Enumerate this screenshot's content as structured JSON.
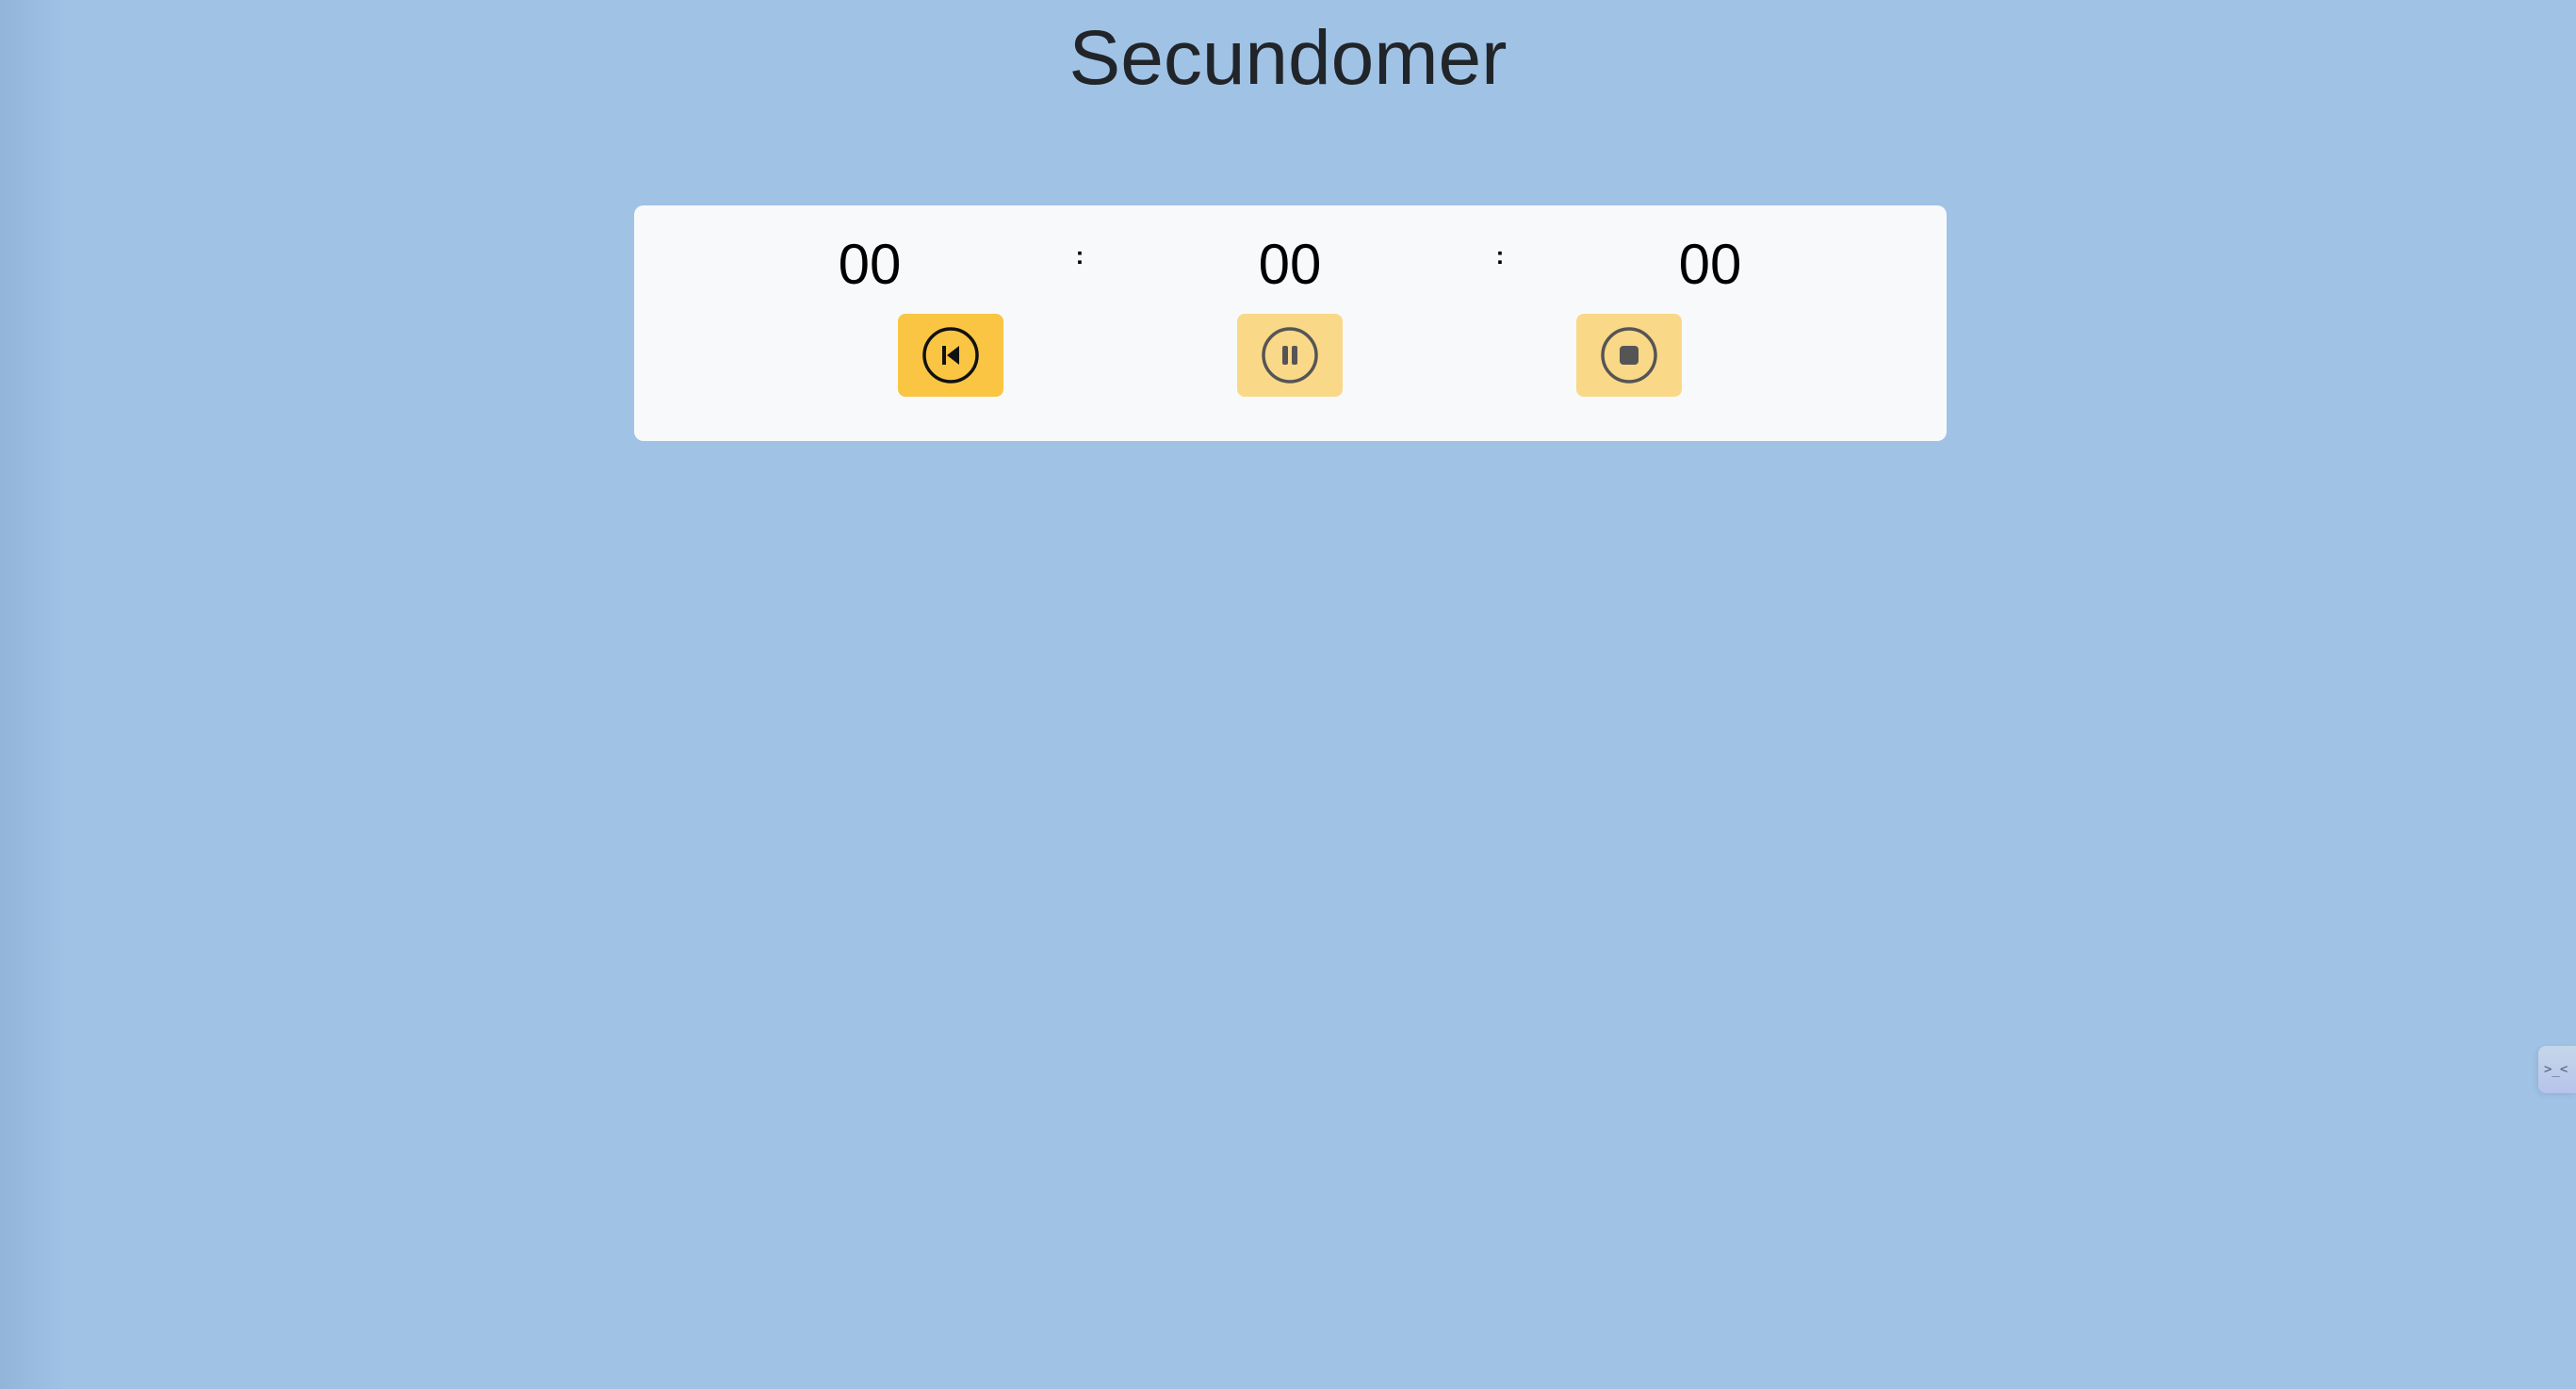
{
  "page": {
    "title": "Secundomer"
  },
  "timer": {
    "hours": "00",
    "minutes": "00",
    "seconds": "00",
    "separator": ":"
  },
  "controls": [
    {
      "icon": "reset-icon",
      "state": "active"
    },
    {
      "icon": "pause-icon",
      "state": "disabled"
    },
    {
      "icon": "stop-icon",
      "state": "disabled"
    }
  ],
  "side_widget": {
    "icon": "terminal-prompt-icon",
    "glyph": ">_<"
  },
  "colors": {
    "background": "#a0c2e5",
    "card": "#f8f9fb",
    "button_active": "#f9c543",
    "button_disabled": "#f9d888",
    "title": "#212529"
  }
}
